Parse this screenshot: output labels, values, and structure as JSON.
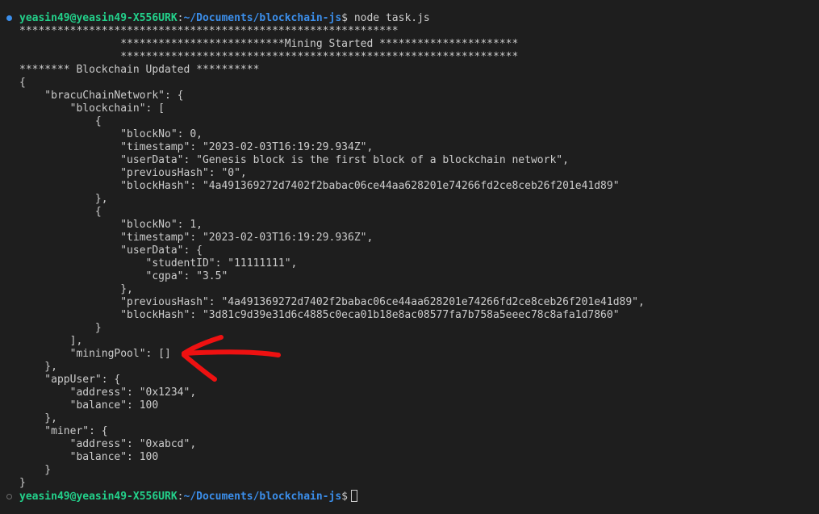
{
  "terminal": {
    "prompt_user": "yeasin49@yeasin49-X556URK",
    "prompt_sep": ":",
    "prompt_path": "~/Documents/blockchain-js",
    "prompt_dollar": "$",
    "command": " node task.js",
    "output": [
      "************************************************************",
      "                **************************Mining Started **********************",
      "                ***************************************************************",
      "******** Blockchain Updated **********",
      "{",
      "    \"bracuChainNetwork\": {",
      "        \"blockchain\": [",
      "            {",
      "                \"blockNo\": 0,",
      "                \"timestamp\": \"2023-02-03T16:19:29.934Z\",",
      "                \"userData\": \"Genesis block is the first block of a blockchain network\",",
      "                \"previousHash\": \"0\",",
      "                \"blockHash\": \"4a491369272d7402f2babac06ce44aa628201e74266fd2ce8ceb26f201e41d89\"",
      "            },",
      "            {",
      "                \"blockNo\": 1,",
      "                \"timestamp\": \"2023-02-03T16:19:29.936Z\",",
      "                \"userData\": {",
      "                    \"studentID\": \"11111111\",",
      "                    \"cgpa\": \"3.5\"",
      "                },",
      "                \"previousHash\": \"4a491369272d7402f2babac06ce44aa628201e74266fd2ce8ceb26f201e41d89\",",
      "                \"blockHash\": \"3d81c9d39e31d6c4885c0eca01b18e8ac08577fa7b758a5eeec78c8afa1d7860\"",
      "            }",
      "        ],",
      "        \"miningPool\": []",
      "    },",
      "    \"appUser\": {",
      "        \"address\": \"0x1234\",",
      "        \"balance\": 100",
      "    },",
      "    \"miner\": {",
      "        \"address\": \"0xabcd\",",
      "        \"balance\": 100",
      "    }",
      "}"
    ]
  },
  "annotation": {
    "shape": "arrow",
    "color": "#ee1111",
    "points_to": "miningPool"
  },
  "colors": {
    "background": "#1e1e1e",
    "text": "#cccccc",
    "prompt_user": "#23d18b",
    "prompt_path": "#3b8eea"
  }
}
